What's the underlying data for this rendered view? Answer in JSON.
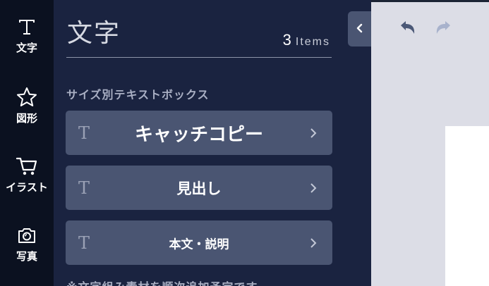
{
  "sidebar": {
    "items": [
      {
        "label": "文字",
        "icon": "text-icon"
      },
      {
        "label": "図形",
        "icon": "star-icon"
      },
      {
        "label": "イラスト",
        "icon": "cart-icon"
      },
      {
        "label": "写真",
        "icon": "camera-icon"
      }
    ]
  },
  "panel": {
    "title": "文字",
    "count": "3",
    "count_unit": "Items",
    "section_label": "サイズ別テキストボックス",
    "buttons": [
      {
        "label": "キャッチコピー",
        "glyph": "T"
      },
      {
        "label": "見出し",
        "glyph": "T"
      },
      {
        "label": "本文・説明",
        "glyph": "T"
      }
    ],
    "footnote": "※文字組み素材を順次追加予定です"
  },
  "colors": {
    "rail_bg": "#0b1120",
    "panel_bg": "#1a2340",
    "button_bg": "#4a5572",
    "editor_bg": "#dcdde6",
    "undo": "#4b5877",
    "redo_disabled": "#a8b2cc"
  }
}
